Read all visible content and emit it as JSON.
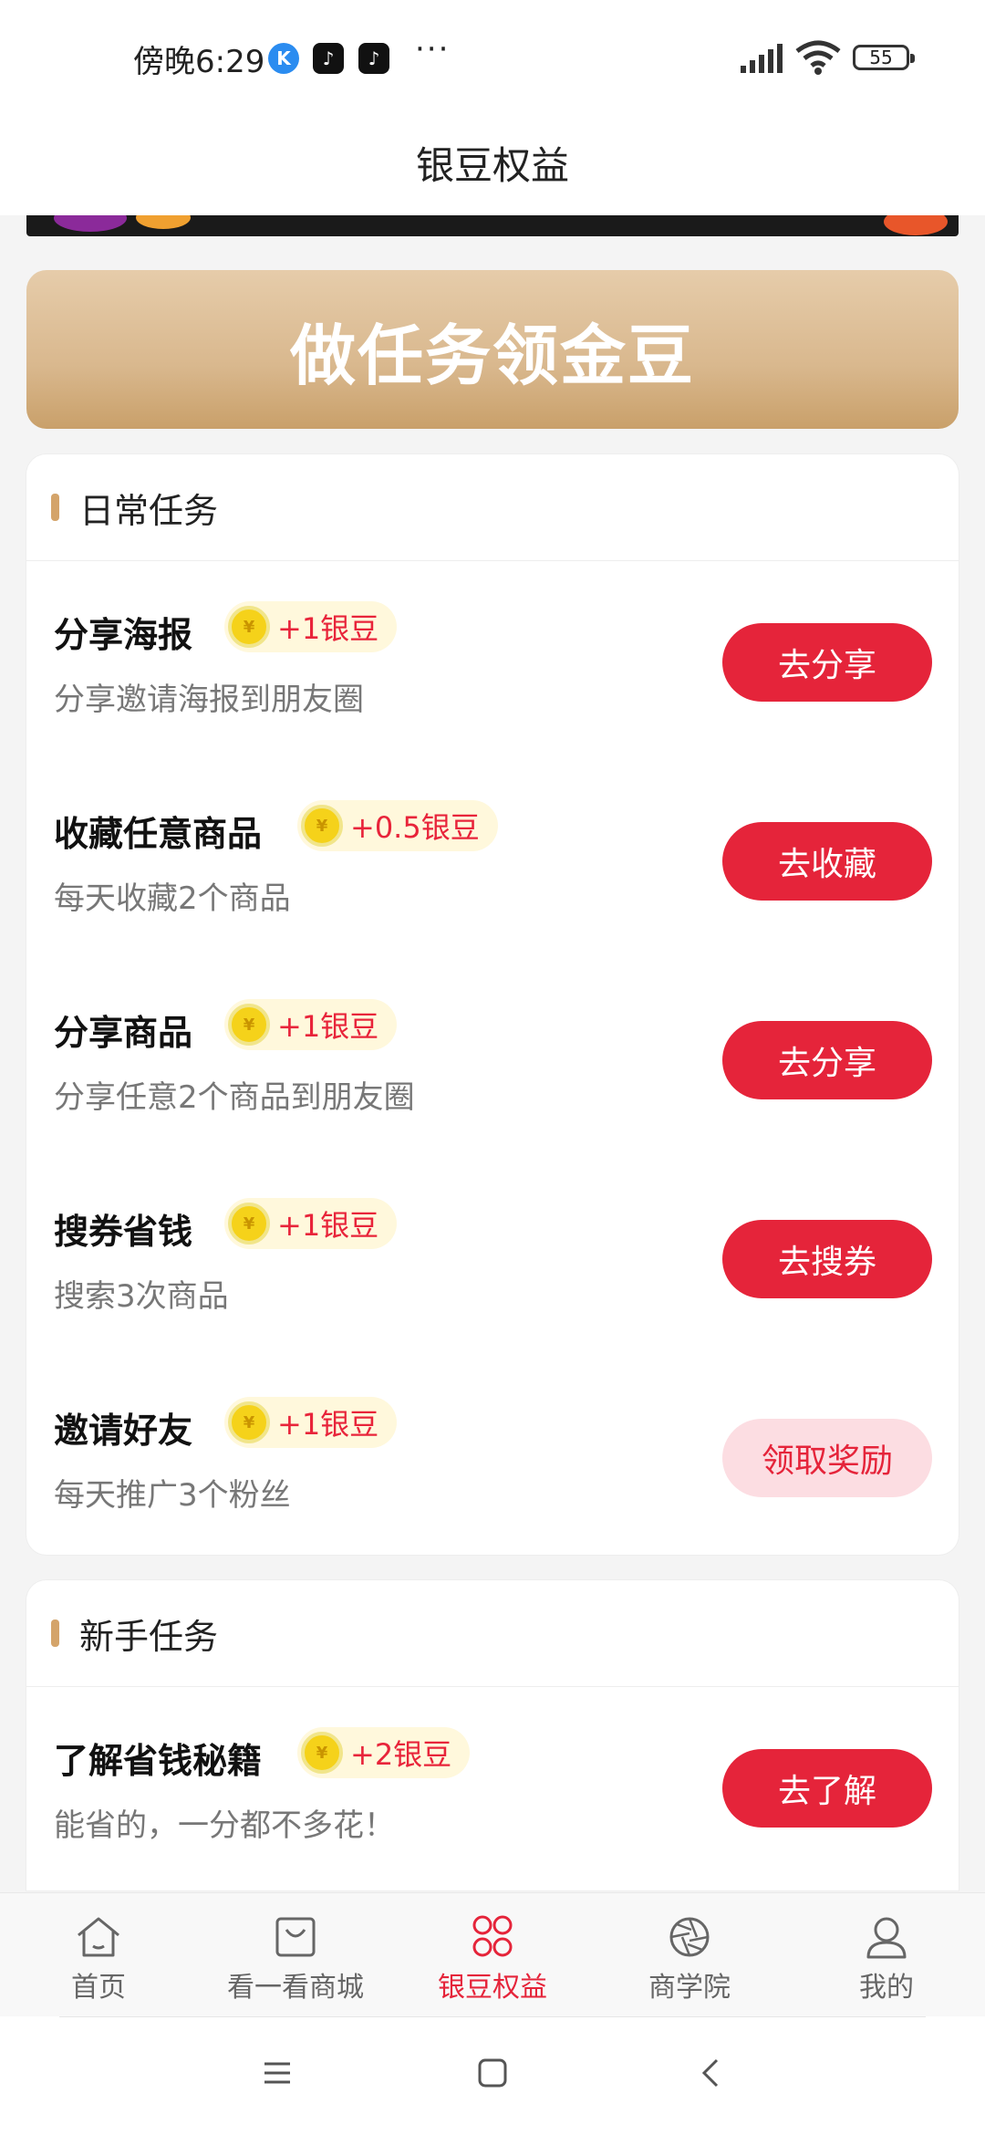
{
  "status_bar": {
    "time": "傍晚6:29",
    "app_icons": [
      {
        "name": "kuaishou-icon",
        "glyph": "K",
        "color": "#2b8cf0"
      },
      {
        "name": "tiktok-icon",
        "glyph": "♪",
        "color": "#111111"
      },
      {
        "name": "tiktok-icon-2",
        "glyph": "♪",
        "color": "#111111"
      }
    ],
    "more": "···",
    "battery": "55"
  },
  "header": {
    "title": "银豆权益"
  },
  "banner": {
    "title": "做任务领金豆"
  },
  "daily_section": {
    "title": "日常任务",
    "tasks": [
      {
        "name": "分享海报",
        "reward": "+1银豆",
        "desc": "分享邀请海报到朋友圈",
        "action": "去分享",
        "style": "primary"
      },
      {
        "name": "收藏任意商品",
        "reward": "+0.5银豆",
        "desc": "每天收藏2个商品",
        "action": "去收藏",
        "style": "primary"
      },
      {
        "name": "分享商品",
        "reward": "+1银豆",
        "desc": "分享任意2个商品到朋友圈",
        "action": "去分享",
        "style": "primary"
      },
      {
        "name": "搜券省钱",
        "reward": "+1银豆",
        "desc": "搜索3次商品",
        "action": "去搜券",
        "style": "primary"
      },
      {
        "name": "邀请好友",
        "reward": "+1银豆",
        "desc": "每天推广3个粉丝",
        "action": "领取奖励",
        "style": "claim"
      }
    ]
  },
  "newbie_section": {
    "title": "新手任务",
    "tasks": [
      {
        "name": "了解省钱秘籍",
        "reward": "+2银豆",
        "desc": "能省的，一分都不多花！",
        "action": "去了解",
        "style": "primary"
      }
    ]
  },
  "coin_symbol": "¥",
  "tabbar": {
    "tabs": [
      {
        "label": "首页",
        "icon": "home-icon",
        "active": false
      },
      {
        "label": "看一看商城",
        "icon": "shopping-bag-icon",
        "active": false
      },
      {
        "label": "银豆权益",
        "icon": "clover-icon",
        "active": true
      },
      {
        "label": "商学院",
        "icon": "aperture-icon",
        "active": false
      },
      {
        "label": "我的",
        "icon": "user-icon",
        "active": false
      }
    ]
  },
  "colors": {
    "accent": "#e5243a",
    "banner_gold": "#d9b88e",
    "reward_bg": "#fff8dc",
    "claim_bg": "#fcdde2"
  }
}
